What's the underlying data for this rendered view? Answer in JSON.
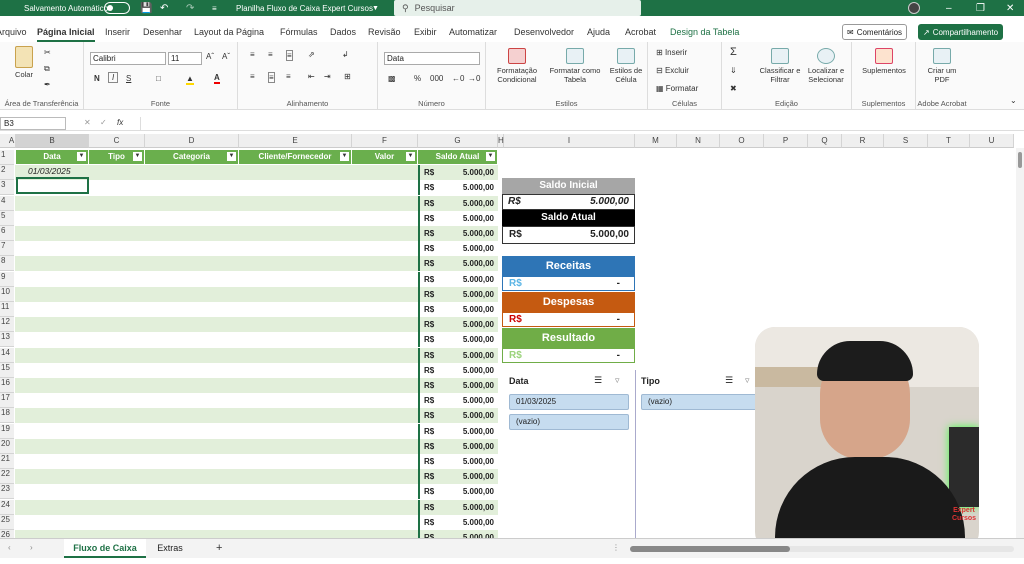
{
  "titlebar": {
    "autosave_label": "Salvamento Automático",
    "doc_title": "Planilha Fluxo de Caixa Expert Cursos",
    "search_placeholder": "Pesquisar"
  },
  "ribbon_tabs": [
    "Arquivo",
    "Página Inicial",
    "Inserir",
    "Desenhar",
    "Layout da Página",
    "Fórmulas",
    "Dados",
    "Revisão",
    "Exibir",
    "Automatizar",
    "Desenvolvedor",
    "Ajuda",
    "Acrobat",
    "Design da Tabela"
  ],
  "top_buttons": {
    "comments": "Comentários",
    "share": "Compartilhamento"
  },
  "ribbon": {
    "clipboard": {
      "paste": "Colar",
      "label": "Área de Transferência"
    },
    "font": {
      "name": "Calibri",
      "size": "11",
      "label": "Fonte",
      "bold": "N",
      "italic": "I",
      "underline": "S"
    },
    "alignment": {
      "label": "Alinhamento"
    },
    "number": {
      "format": "Data",
      "label": "Número"
    },
    "styles": {
      "cond": "Formatação Condicional",
      "table": "Formatar como Tabela",
      "cell": "Estilos de Célula",
      "label": "Estilos"
    },
    "cells": {
      "insert": "Inserir",
      "delete": "Excluir",
      "format": "Formatar",
      "label": "Células"
    },
    "editing": {
      "sort": "Classificar e Filtrar",
      "find": "Localizar e Selecionar",
      "label": "Edição"
    },
    "addins": {
      "btn": "Suplementos",
      "label": "Suplementos"
    },
    "acrobat": {
      "btn": "Criar um PDF",
      "label": "Adobe Acrobat"
    }
  },
  "formula_bar": {
    "name_box": "B3",
    "fx": "fx",
    "content": ""
  },
  "columns": [
    "A",
    "B",
    "C",
    "D",
    "E",
    "F",
    "G",
    "H",
    "I",
    "M",
    "N",
    "O",
    "P",
    "Q",
    "R",
    "S",
    "T",
    "U"
  ],
  "rows": [
    "1",
    "2",
    "3",
    "4",
    "5",
    "6",
    "7",
    "8",
    "9",
    "10",
    "11",
    "12",
    "13",
    "14",
    "15",
    "16",
    "17",
    "18",
    "19",
    "20",
    "21",
    "22",
    "23",
    "24",
    "25",
    "26"
  ],
  "table": {
    "headers": [
      "Data",
      "Tipo",
      "Categoria",
      "Cliente/Fornecedor",
      "Valor",
      "Saldo Atual"
    ],
    "first_date": "01/03/2025",
    "currency": "R$",
    "saldo_values": [
      "5.000,00",
      "5.000,00",
      "5.000,00",
      "5.000,00",
      "5.000,00",
      "5.000,00",
      "5.000,00",
      "5.000,00",
      "5.000,00",
      "5.000,00",
      "5.000,00",
      "5.000,00",
      "5.000,00",
      "5.000,00",
      "5.000,00",
      "5.000,00",
      "5.000,00",
      "5.000,00",
      "5.000,00",
      "5.000,00",
      "5.000,00",
      "5.000,00",
      "5.000,00",
      "5.000,00",
      "5.000,00"
    ]
  },
  "summary": {
    "saldo_inicial_label": "Saldo Inicial",
    "saldo_inicial_value": "5.000,00",
    "saldo_atual_label": "Saldo Atual",
    "saldo_atual_value": "5.000,00",
    "receitas_label": "Receitas",
    "receitas_value": "-",
    "despesas_label": "Despesas",
    "despesas_value": "-",
    "resultado_label": "Resultado",
    "resultado_value": "-",
    "currency": "R$"
  },
  "slicers": {
    "data": {
      "title": "Data",
      "items": [
        "01/03/2025",
        "(vazio)"
      ]
    },
    "tipo": {
      "title": "Tipo",
      "items": [
        "(vazio)"
      ]
    }
  },
  "sheet_tabs": [
    "Fluxo de Caixa",
    "Extras"
  ],
  "webcam_logo": "Expert Cursos",
  "colors": {
    "excel_green": "#1e7145",
    "table_header": "#6aaf4d",
    "receitas": "#2e75b6",
    "despesas": "#c55a11",
    "resultado": "#70ad47"
  }
}
